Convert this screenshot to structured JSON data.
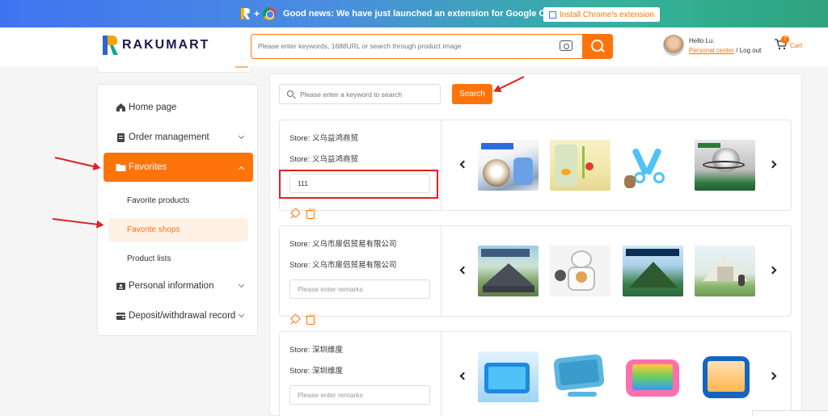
{
  "banner": {
    "text": "Good news: We have just launched an extension for Google Chrome",
    "button_label": "Install Chrome's extension"
  },
  "header": {
    "logo_text": "RAKUMART",
    "search_placeholder": "Please enter keywords, 1688URL or search through product image",
    "greeting": "Hello Lu.",
    "personal_center": "Personal center",
    "separator": " / ",
    "logout": "Log out",
    "cart_count": "7",
    "cart_label": "Cart"
  },
  "sidebar": {
    "items": [
      {
        "label": "Home page",
        "icon": "home-icon"
      },
      {
        "label": "Order management",
        "icon": "clipboard-icon"
      },
      {
        "label": "Favorites",
        "icon": "folder-icon"
      },
      {
        "label": "Personal information",
        "icon": "id-card-icon"
      },
      {
        "label": "Deposit/withdrawal record",
        "icon": "wallet-icon"
      }
    ],
    "favorites_sub": [
      {
        "label": "Favorite products"
      },
      {
        "label": "Favorite shops"
      },
      {
        "label": "Product lists"
      }
    ]
  },
  "main": {
    "keyword_placeholder": "Please enter a keyword to search",
    "search_button": "Search",
    "remark_placeholder": "Please enter remarks",
    "shops": [
      {
        "store_line_1": "Store: 义乌益鸿商贸",
        "store_line_2": "Store: 义乌益鸿商贸",
        "remark": "111"
      },
      {
        "store_line_1": "Store: 义乌市扉侣贸易有限公司",
        "store_line_2": "Store: 义乌市扉侣贸易有限公司",
        "remark": ""
      },
      {
        "store_line_1": "Store: 深圳维度",
        "store_line_2": "Store: 深圳维度",
        "remark": ""
      }
    ]
  },
  "colors": {
    "accent": "#ff730b",
    "annotation_red": "#e02020"
  }
}
